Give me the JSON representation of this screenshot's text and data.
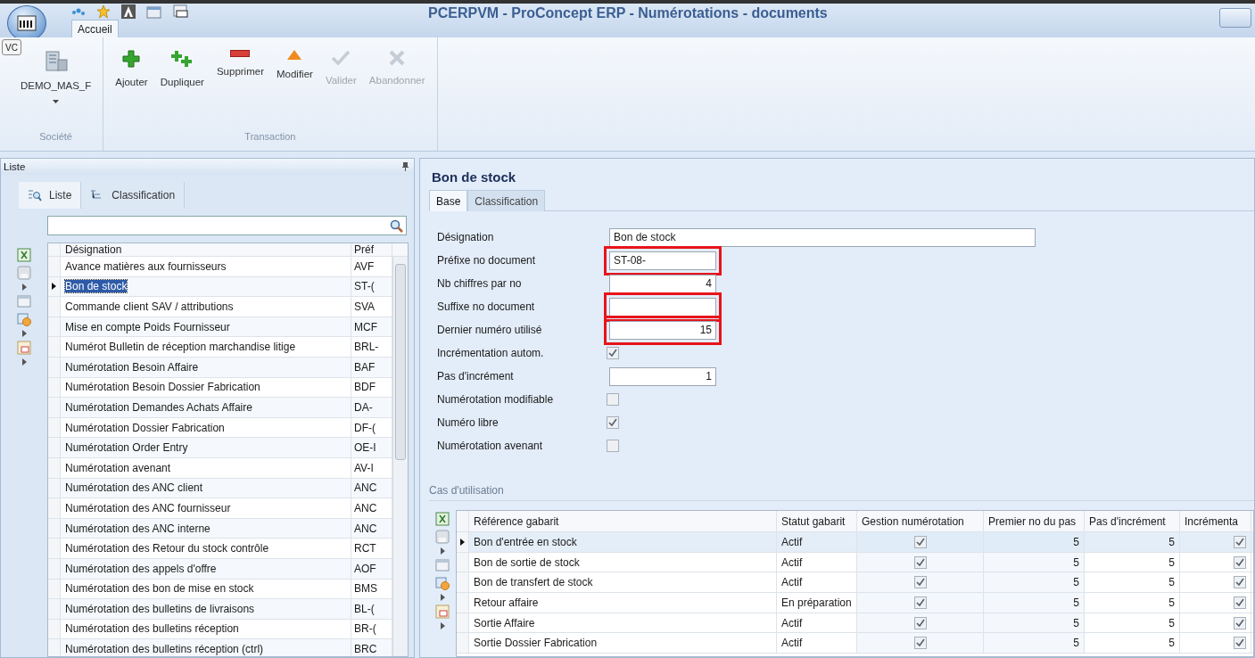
{
  "window": {
    "title": "PCERPVM - ProConcept ERP - Numérotations - documents"
  },
  "ribbon_tabs": [
    {
      "label": "Accueil",
      "selected": true
    }
  ],
  "ribbon": {
    "company_badge": "VC",
    "groups": [
      {
        "label": "Société",
        "buttons": [
          {
            "label": "DEMO_MAS_F",
            "disabled": false,
            "dropdown": true
          }
        ]
      },
      {
        "label": "Transaction",
        "buttons": [
          {
            "label": "Ajouter",
            "disabled": false
          },
          {
            "label": "Dupliquer",
            "disabled": false
          },
          {
            "label": "Supprimer",
            "disabled": false
          },
          {
            "label": "Modifier",
            "disabled": false
          },
          {
            "label": "Valider",
            "disabled": true
          },
          {
            "label": "Abandonner",
            "disabled": true
          }
        ]
      }
    ]
  },
  "list_panel": {
    "title": "Liste",
    "tabs": [
      {
        "label": "Liste",
        "selected": true
      },
      {
        "label": "Classification",
        "selected": false
      }
    ],
    "columns": [
      "Désignation",
      "Préf"
    ],
    "rows": [
      {
        "name": "Avance matières aux fournisseurs",
        "prefix": "AVF",
        "selected": false
      },
      {
        "name": "Bon de stock",
        "prefix": "ST-(",
        "selected": true
      },
      {
        "name": "Commande client SAV  / attributions",
        "prefix": "SVA",
        "selected": false
      },
      {
        "name": "Mise en compte Poids Fournisseur",
        "prefix": "MCF",
        "selected": false
      },
      {
        "name": "Numérot Bulletin de réception marchandise litige",
        "prefix": "BRL-",
        "selected": false
      },
      {
        "name": "Numérotation Besoin Affaire",
        "prefix": "BAF",
        "selected": false
      },
      {
        "name": "Numérotation Besoin Dossier Fabrication",
        "prefix": "BDF",
        "selected": false
      },
      {
        "name": "Numérotation Demandes Achats Affaire",
        "prefix": "DA-",
        "selected": false
      },
      {
        "name": "Numérotation Dossier Fabrication",
        "prefix": "DF-(",
        "selected": false
      },
      {
        "name": "Numérotation Order Entry",
        "prefix": "OE-I",
        "selected": false
      },
      {
        "name": "Numérotation avenant",
        "prefix": "AV-I",
        "selected": false
      },
      {
        "name": "Numérotation des ANC client",
        "prefix": "ANC",
        "selected": false
      },
      {
        "name": "Numérotation des ANC fournisseur",
        "prefix": "ANC",
        "selected": false
      },
      {
        "name": "Numérotation des ANC interne",
        "prefix": "ANC",
        "selected": false
      },
      {
        "name": "Numérotation des Retour du stock contrôle",
        "prefix": "RCT",
        "selected": false
      },
      {
        "name": "Numérotation des appels d'offre",
        "prefix": "AOF",
        "selected": false
      },
      {
        "name": "Numérotation des bon de mise en stock",
        "prefix": "BMS",
        "selected": false
      },
      {
        "name": "Numérotation des bulletins de livraisons",
        "prefix": "BL-(",
        "selected": false
      },
      {
        "name": "Numérotation des bulletins réception",
        "prefix": "BR-(",
        "selected": false
      },
      {
        "name": "Numérotation des bulletins réception (ctrl)",
        "prefix": "BRC",
        "selected": false
      }
    ]
  },
  "detail": {
    "title": "Bon de stock",
    "tabs": [
      {
        "label": "Base",
        "selected": true
      },
      {
        "label": "Classification",
        "selected": false
      }
    ],
    "fields": [
      {
        "kind": "text",
        "label": "Désignation",
        "value": "Bon de stock",
        "wide": true,
        "highlighted": false
      },
      {
        "kind": "text",
        "label": "Préfixe no document",
        "value": "ST-08-",
        "highlighted": true
      },
      {
        "kind": "number",
        "label": "Nb chiffres par no",
        "value": "4",
        "highlighted": false
      },
      {
        "kind": "text",
        "label": "Suffixe no document",
        "highlighted": true
      },
      {
        "kind": "number",
        "label": "Dernier numéro utilisé",
        "value": "15",
        "highlighted": true
      },
      {
        "kind": "checkbox",
        "label": "Incrémentation autom.",
        "checked": true
      },
      {
        "kind": "number",
        "label": "Pas d'incrément",
        "value": "1",
        "highlighted": false
      },
      {
        "kind": "checkbox",
        "label": "Numérotation modifiable",
        "checked": false
      },
      {
        "kind": "checkbox",
        "label": "Numéro libre",
        "checked": true
      },
      {
        "kind": "checkbox",
        "label": "Numérotation avenant",
        "checked": false
      }
    ],
    "usage": {
      "title": "Cas d'utilisation",
      "columns": [
        "Référence gabarit",
        "Statut gabarit",
        "Gestion numérotation",
        "Premier no du pas",
        "Pas d'incrément",
        "Incrémenta"
      ],
      "rows": [
        {
          "reference": "Bon d'entrée en stock",
          "status": "Actif",
          "managed": true,
          "first": "5",
          "step": "5",
          "increment": true,
          "selected": true
        },
        {
          "reference": "Bon de sortie de stock",
          "status": "Actif",
          "managed": true,
          "first": "5",
          "step": "5",
          "increment": true,
          "selected": false
        },
        {
          "reference": "Bon de transfert de stock",
          "status": "Actif",
          "managed": true,
          "first": "5",
          "step": "5",
          "increment": true,
          "selected": false
        },
        {
          "reference": "Retour affaire",
          "status": "En préparation",
          "managed": true,
          "first": "5",
          "step": "5",
          "increment": true,
          "selected": false
        },
        {
          "reference": "Sortie Affaire",
          "status": "Actif",
          "managed": true,
          "first": "5",
          "step": "5",
          "increment": true,
          "selected": false
        },
        {
          "reference": "Sortie Dossier Fabrication",
          "status": "Actif",
          "managed": true,
          "first": "5",
          "step": "5",
          "increment": true,
          "selected": false
        }
      ]
    }
  }
}
